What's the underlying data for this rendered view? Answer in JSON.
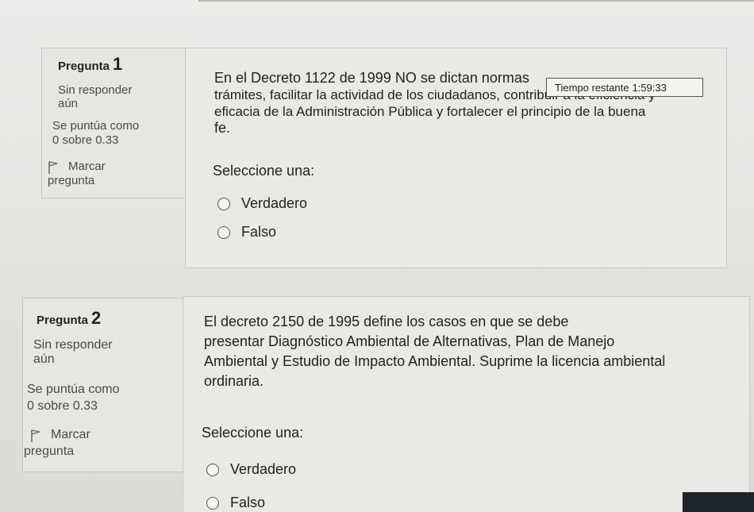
{
  "questions": [
    {
      "title": "Pregunta",
      "number": "1",
      "status_line1": "Sin responder",
      "status_line2": "aún",
      "score_line1": "Se puntúa como",
      "score_line2": "0 sobre 0.33",
      "flag_line1": "Marcar",
      "flag_line2": "pregunta",
      "text_lines": [
        "En el Decreto 1122 de 1999 NO se dictan normas",
        "trámites, facilitar la actividad de los ciudadanos, contribuir a la eficiencia y",
        "eficacia de la Administración Pública y fortalecer el principio de la buena",
        "fe."
      ],
      "prompt": "Seleccione una:",
      "options": [
        "Verdadero",
        "Falso"
      ]
    },
    {
      "title": "Pregunta",
      "number": "2",
      "status_line1": "Sin responder",
      "status_line2": "aún",
      "score_line1": "Se puntúa como",
      "score_line2": "0 sobre 0.33",
      "flag_line1": "Marcar",
      "flag_line2": "pregunta",
      "text_lines": [
        "El decreto 2150 de 1995 define los casos en que se debe",
        "presentar Diagnóstico Ambiental de Alternativas, Plan de Manejo",
        "Ambiental y Estudio de Impacto Ambiental. Suprime la licencia ambiental",
        "ordinaria."
      ],
      "prompt": "Seleccione una:",
      "options": [
        "Verdadero",
        "Falso"
      ]
    }
  ],
  "timer": {
    "label": "Tiempo restante",
    "value": "1:59:33"
  },
  "icons": {
    "flag": "flag-icon",
    "radio": "radio-unchecked-icon"
  }
}
